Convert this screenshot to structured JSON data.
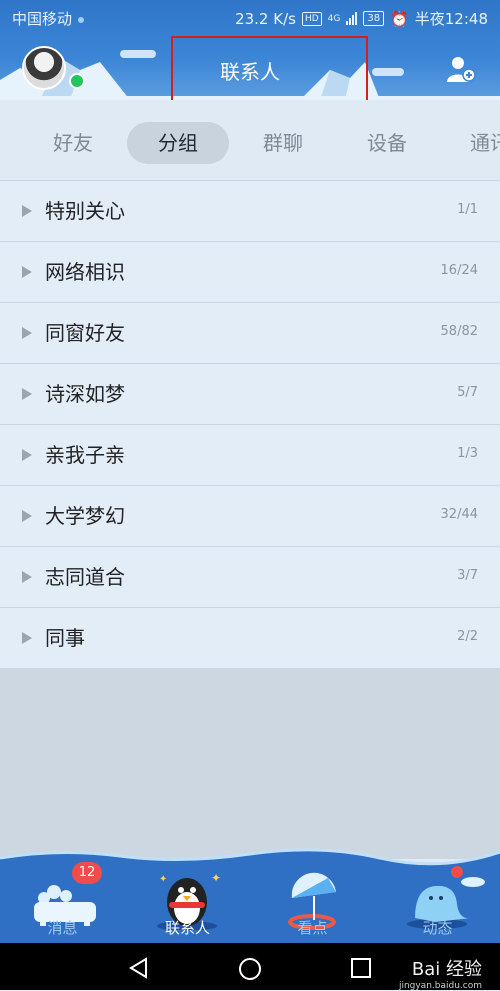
{
  "statusbar": {
    "carrier": "中国移动",
    "speed": "23.2 K/s",
    "hd": "HD",
    "network": "4G",
    "battery": "38",
    "time": "半夜12:48"
  },
  "header": {
    "title": "联系人"
  },
  "tabs": [
    {
      "label": "好友",
      "active": false
    },
    {
      "label": "分组",
      "active": true
    },
    {
      "label": "群聊",
      "active": false
    },
    {
      "label": "设备",
      "active": false
    },
    {
      "label": "通讯",
      "active": false
    }
  ],
  "groups": [
    {
      "name": "特别关心",
      "count": "1/1"
    },
    {
      "name": "网络相识",
      "count": "16/24"
    },
    {
      "name": "同窗好友",
      "count": "58/82"
    },
    {
      "name": "诗深如梦",
      "count": "5/7"
    },
    {
      "name": "亲我子亲",
      "count": "1/3"
    },
    {
      "name": "大学梦幻",
      "count": "32/44"
    },
    {
      "name": "志同道合",
      "count": "3/7"
    },
    {
      "name": "同事",
      "count": "2/2"
    }
  ],
  "bottom_nav": {
    "messages": {
      "label": "消息",
      "badge": "12"
    },
    "contacts": {
      "label": "联系人"
    },
    "watch": {
      "label": "看点"
    },
    "feed": {
      "label": "动态"
    }
  },
  "watermark": {
    "text": "Bai 经验",
    "sub": "jingyan.baidu.com"
  },
  "colors": {
    "header_blue": "#3d86d6",
    "highlight_red": "#d41f1f",
    "badge_red": "#f24b4b",
    "online_green": "#22c55e"
  }
}
